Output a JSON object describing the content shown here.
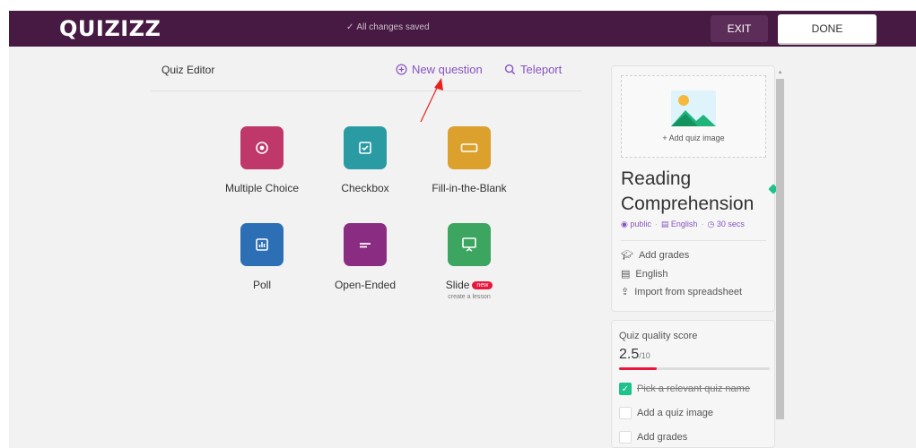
{
  "topbar": {
    "logo": "QUIZIZZ",
    "saved_status": "All changes saved",
    "exit_label": "EXIT",
    "done_label": "DONE"
  },
  "editor": {
    "title": "Quiz Editor",
    "new_question_label": "New question",
    "teleport_label": "Teleport"
  },
  "question_types": [
    {
      "label": "Multiple Choice",
      "color": "#c0376a",
      "icon": "radio-icon"
    },
    {
      "label": "Checkbox",
      "color": "#2a9aa3",
      "icon": "checkbox-icon"
    },
    {
      "label": "Fill-in-the-Blank",
      "color": "#dca02c",
      "icon": "blank-icon"
    },
    {
      "label": "Poll",
      "color": "#2d6fb4",
      "icon": "chart-icon"
    },
    {
      "label": "Open-Ended",
      "color": "#8a2d82",
      "icon": "lines-icon"
    },
    {
      "label": "Slide",
      "color": "#3ca660",
      "icon": "presentation-icon",
      "badge": "new",
      "subtitle": "create a lesson"
    }
  ],
  "sidebar": {
    "add_image_label": "+ Add quiz image",
    "quiz_name": "Reading Comprehension",
    "visibility": "public",
    "language": "English",
    "time": "30 secs",
    "add_grades": "Add grades",
    "language_row": "English",
    "import": "Import from spreadsheet"
  },
  "quality": {
    "title": "Quiz quality score",
    "score": "2.5",
    "max": "/10",
    "score_fraction": 0.25,
    "checklist": [
      {
        "label": "Pick a relevant quiz name",
        "done": true
      },
      {
        "label": "Add a quiz image",
        "done": false
      },
      {
        "label": "Add grades",
        "done": false
      }
    ]
  },
  "colors": {
    "topbar": "#461a42",
    "accent": "#8854c0",
    "score_bar": "#e8163c",
    "check_green": "#1ec28b"
  }
}
